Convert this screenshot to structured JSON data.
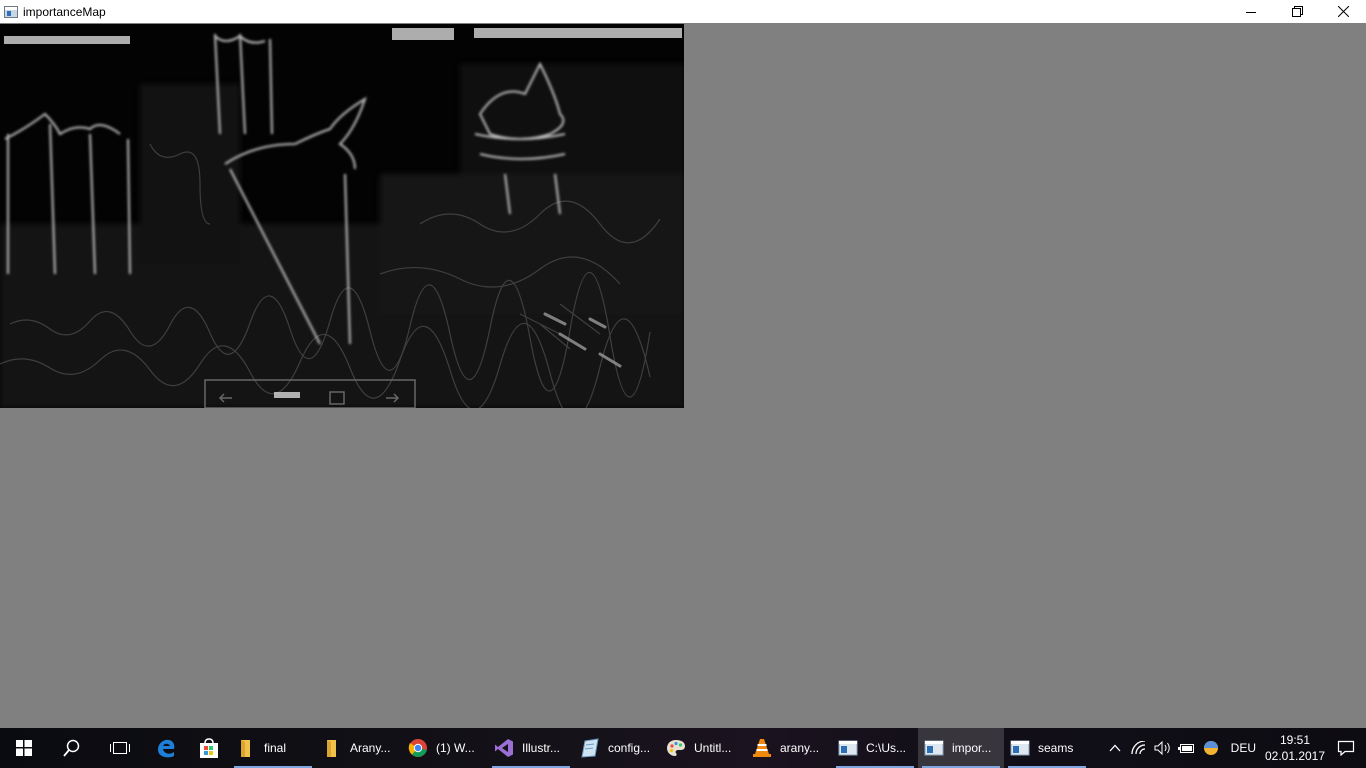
{
  "window": {
    "title": "importanceMap",
    "icon": "app-window-icon",
    "controls": [
      "minimize-icon",
      "restore-icon",
      "close-icon"
    ]
  },
  "image": {
    "description_icon": "importance-map-image"
  },
  "taskbar": {
    "start_icon": "windows-start-icon",
    "search_icon": "search-icon",
    "taskview_icon": "task-view-icon",
    "pinned": [
      {
        "name": "edge-icon"
      },
      {
        "name": "store-icon"
      }
    ],
    "apps": [
      {
        "label": "final",
        "icon": "folder-icon",
        "running": true
      },
      {
        "label": "Arany...",
        "icon": "folder-icon",
        "running": false
      },
      {
        "label": "(1) W...",
        "icon": "chrome-icon",
        "running": false
      },
      {
        "label": "Illustr...",
        "icon": "visual-studio-icon",
        "running": true
      },
      {
        "label": "config...",
        "icon": "notepad-icon",
        "running": false
      },
      {
        "label": "Untitl...",
        "icon": "paint-icon",
        "running": false
      },
      {
        "label": "arany...",
        "icon": "vlc-icon",
        "running": false
      },
      {
        "label": "C:\\Us...",
        "icon": "console-window-icon",
        "running": true
      },
      {
        "label": "impor...",
        "icon": "console-window-icon",
        "running": true,
        "active": true
      },
      {
        "label": "seams",
        "icon": "console-window-icon",
        "running": true
      }
    ],
    "tray": {
      "icons": [
        "chevron-up-icon",
        "wifi-icon",
        "volume-icon",
        "battery-icon",
        "color-ball-icon"
      ],
      "language": "DEU",
      "time": "19:51",
      "date": "02.01.2017",
      "notification_icon": "notification-icon"
    }
  }
}
